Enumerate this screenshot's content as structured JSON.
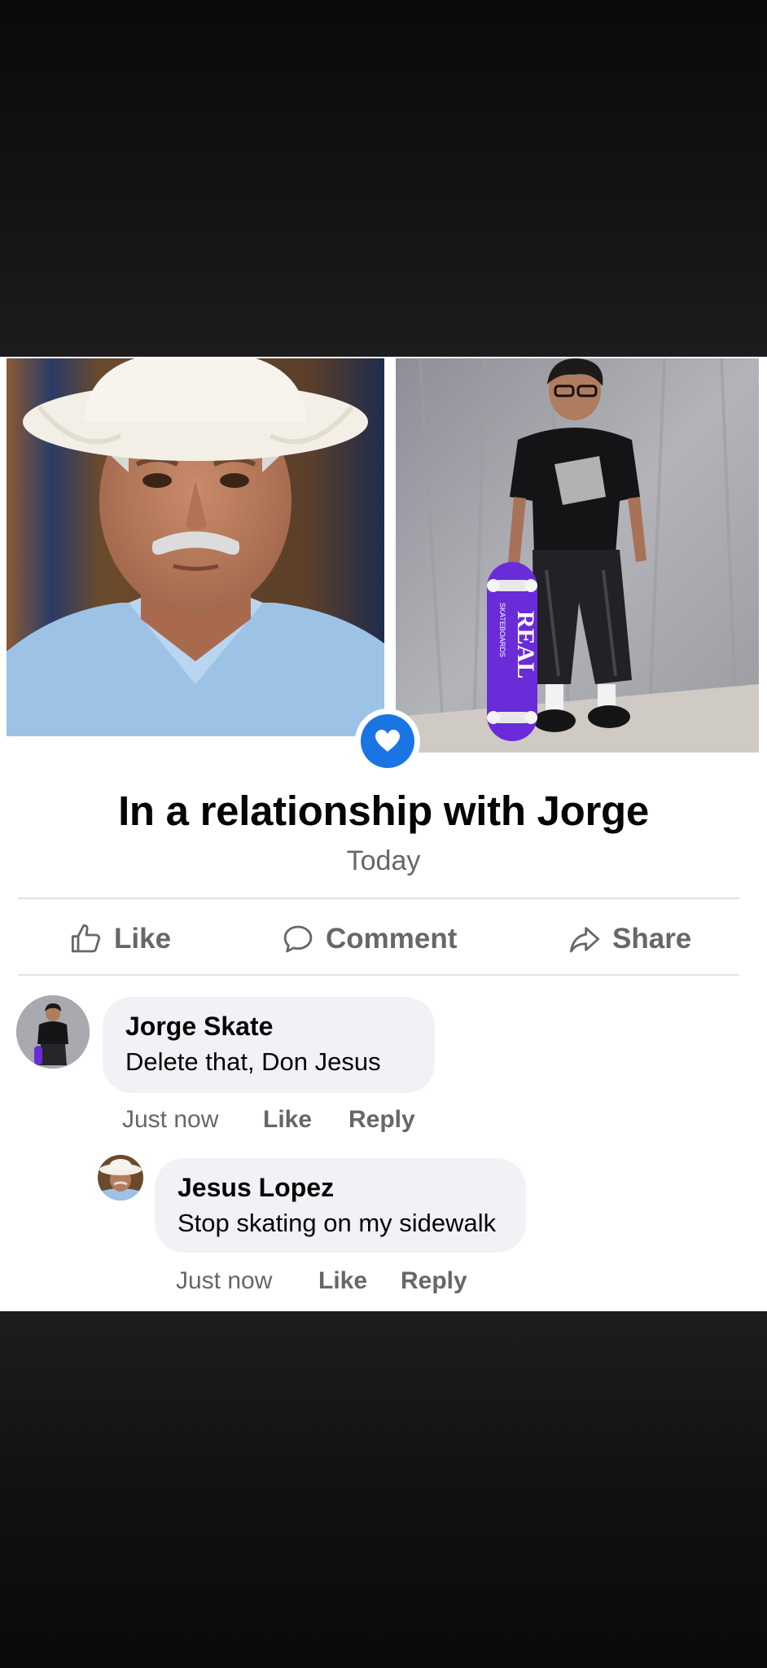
{
  "post": {
    "headline": "In a relationship with Jorge",
    "date": "Today",
    "images": {
      "left": "photo-older-man-in-white-cowboy-hat",
      "right": "photo-young-man-with-purple-skateboard",
      "skateboard_brand": "REAL",
      "skateboard_sub": "SKATEBOARDS"
    },
    "badge_icon": "heart-icon"
  },
  "actions": {
    "like": "Like",
    "comment": "Comment",
    "share": "Share"
  },
  "comments": [
    {
      "author": "Jorge Skate",
      "text": "Delete that, Don Jesus",
      "time": "Just now",
      "like": "Like",
      "reply": "Reply"
    },
    {
      "author": "Jesus Lopez",
      "text": "Stop skating on my sidewalk",
      "time": "Just now",
      "like": "Like",
      "reply": "Reply"
    }
  ],
  "colors": {
    "accent": "#1b74e4",
    "muted_text": "#65676b",
    "bubble": "#f0f2f5",
    "skateboard": "#6a2bd8"
  }
}
